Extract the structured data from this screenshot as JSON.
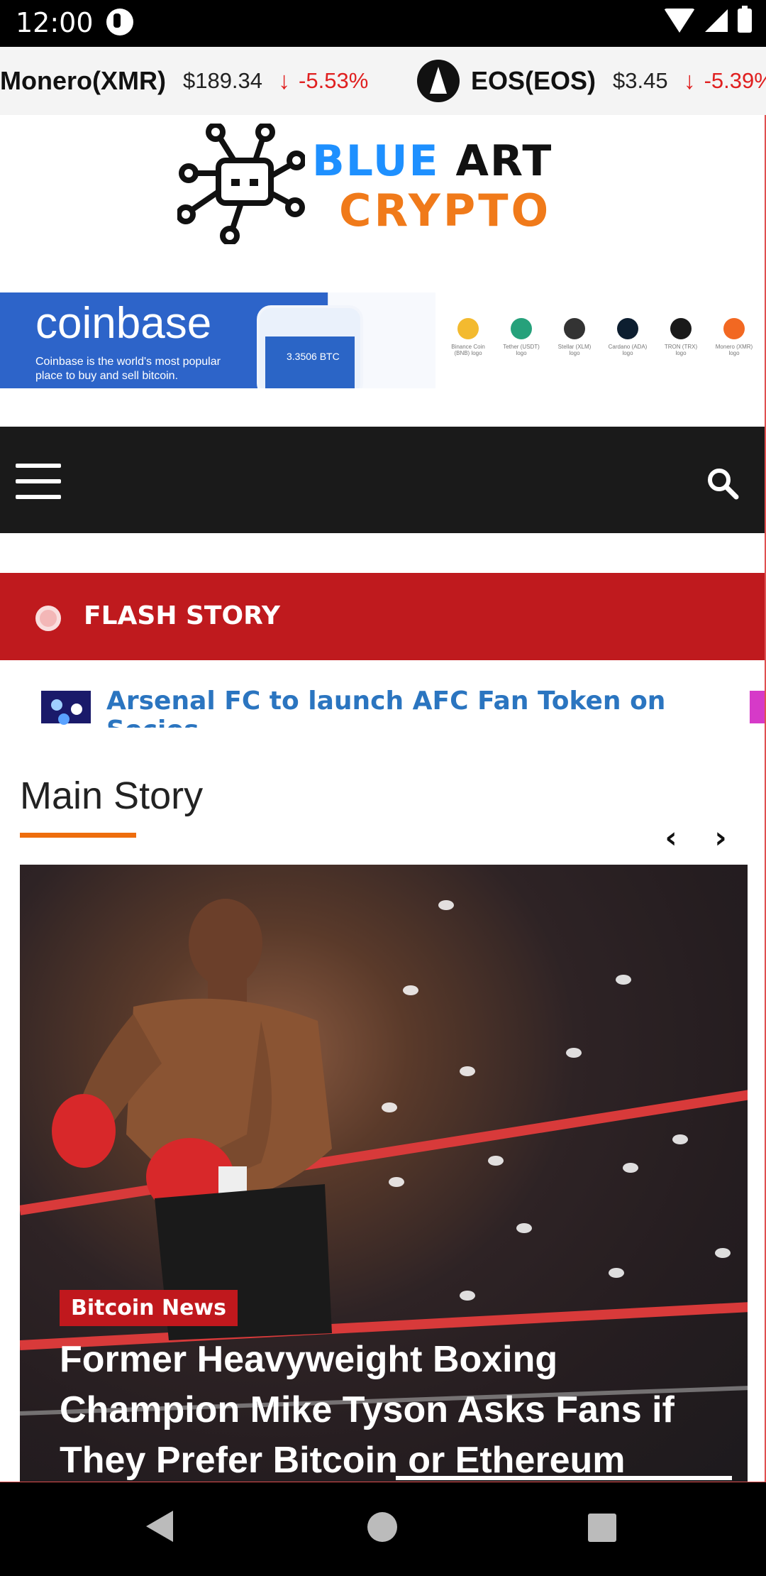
{
  "status_bar": {
    "time": "12:00"
  },
  "ticker": [
    {
      "name": "Monero(XMR)",
      "price": "$189.34",
      "arrow": "↓",
      "change": "-5.53%"
    },
    {
      "name": "EOS(EOS)",
      "price": "$3.45",
      "arrow": "↓",
      "change": "-5.39%"
    }
  ],
  "logo": {
    "line1_blue": "BLUE",
    "line1_dark": "ART",
    "line2": "CRYPTO"
  },
  "banner": {
    "brand": "coinbase",
    "tagline": "Coinbase is the world's most popular place to buy and sell bitcoin.",
    "phone_value": "3.3506 BTC",
    "coins": [
      {
        "label": "Binance Coin (BNB) logo",
        "color": "#f3ba2f"
      },
      {
        "label": "Tether (USDT) logo",
        "color": "#26a17b"
      },
      {
        "label": "Stellar (XLM) logo",
        "color": "#333333"
      },
      {
        "label": "Cardano (ADA) logo",
        "color": "#0d1e30"
      },
      {
        "label": "TRON (TRX) logo",
        "color": "#1a1a1a"
      },
      {
        "label": "Monero (XMR) logo",
        "color": "#f26822"
      }
    ]
  },
  "colors": {
    "accent_red": "#bf1a1e",
    "accent_orange": "#ee6d0d",
    "link_blue": "#2b75c0",
    "nav_dark": "#1a1a1a"
  },
  "nav": {
    "menu_icon": "hamburger-icon",
    "search_icon": "search-icon"
  },
  "flash": {
    "label": "FLASH STORY",
    "headline": "Arsenal FC to launch AFC Fan Token on Socios"
  },
  "main": {
    "section_title": "Main Story",
    "prev_icon": "chevron-left-icon",
    "next_icon": "chevron-right-icon",
    "prev_glyph": "‹",
    "next_glyph": "›",
    "story": {
      "category": "Bitcoin News",
      "title": "Former Heavyweight Boxing Champion Mike Tyson Asks Fans if They Prefer Bitcoin or Ethereum"
    }
  }
}
